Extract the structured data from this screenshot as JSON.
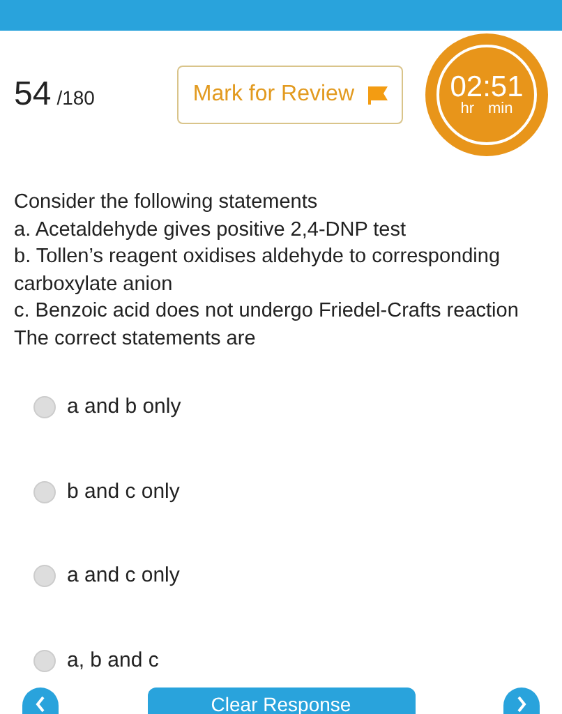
{
  "question_number": "54",
  "question_total": "/180",
  "mark_for_review": {
    "label": "Mark for Review"
  },
  "timer": {
    "time": "02:51",
    "hours_label": "hr",
    "minutes_label": "min"
  },
  "question": {
    "intro": "Consider the following statements",
    "statements": [
      "a. Acetaldehyde gives positive 2,4-DNP test",
      "b. Tollen’s reagent oxidises aldehyde to corresponding carboxylate anion",
      "c. Benzoic acid does not undergo Friedel-Crafts reaction"
    ],
    "prompt": "The correct statements are"
  },
  "options": [
    {
      "label": "a and b only",
      "selected": false
    },
    {
      "label": "b and c only",
      "selected": false
    },
    {
      "label": "a and c only",
      "selected": false
    },
    {
      "label": "a, b and c",
      "selected": false
    }
  ],
  "bottom_bar": {
    "clear_button": "Clear Response"
  }
}
